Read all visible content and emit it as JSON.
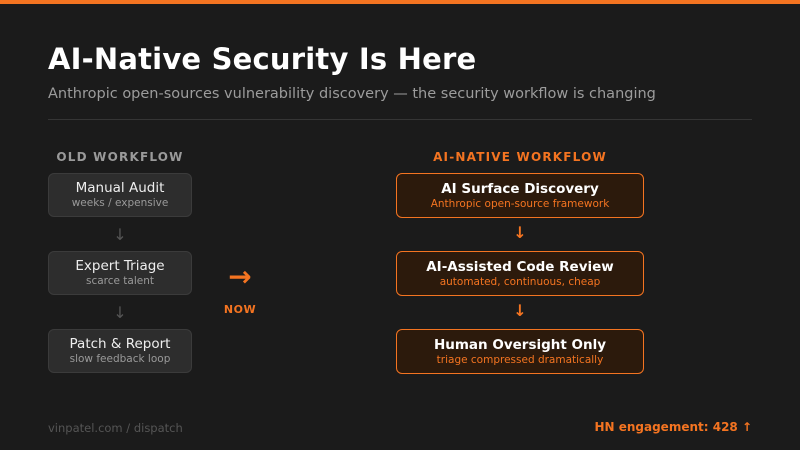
{
  "header": {
    "title": "AI-Native Security Is Here",
    "subtitle": "Anthropic open-sources vulnerability discovery — the security workflow is changing"
  },
  "old_workflow": {
    "heading": "OLD WORKFLOW",
    "steps": [
      {
        "title": "Manual Audit",
        "sub": "weeks / expensive"
      },
      {
        "title": "Expert Triage",
        "sub": "scarce talent"
      },
      {
        "title": "Patch & Report",
        "sub": "slow feedback loop"
      }
    ],
    "arrow": "↓"
  },
  "transition": {
    "arrow": "→",
    "label": "NOW"
  },
  "new_workflow": {
    "heading": "AI-NATIVE WORKFLOW",
    "steps": [
      {
        "title": "AI Surface Discovery",
        "sub": "Anthropic open-source framework"
      },
      {
        "title": "AI-Assisted Code Review",
        "sub": "automated, continuous, cheap"
      },
      {
        "title": "Human Oversight Only",
        "sub": "triage compressed dramatically"
      }
    ],
    "arrow": "↓"
  },
  "footer": {
    "source": "vinpatel.com / dispatch",
    "engagement": "HN engagement: 428 ↑"
  },
  "colors": {
    "accent": "#f47421",
    "background": "#1b1b1b"
  }
}
